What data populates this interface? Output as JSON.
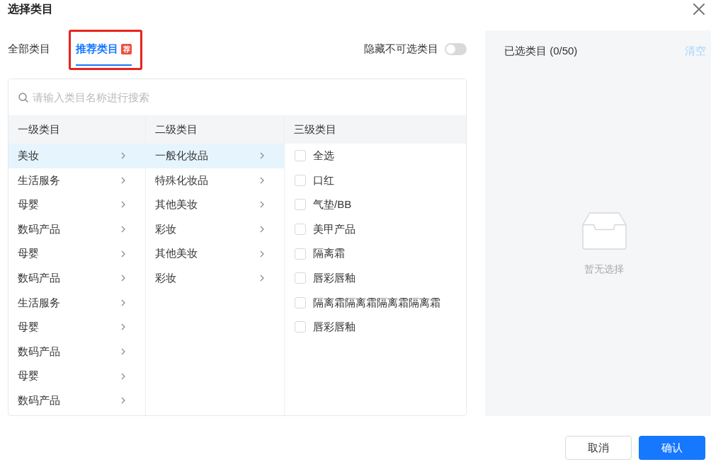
{
  "dialog": {
    "title": "选择类目"
  },
  "tabs": [
    {
      "label": "全部类目",
      "selected": false,
      "highlighted": false
    },
    {
      "label": "推荐类目",
      "selected": true,
      "badge": "荐",
      "highlighted": true
    }
  ],
  "hide_unavailable": {
    "label": "隐藏不可选类目",
    "on": false
  },
  "search": {
    "placeholder": "请输入类目名称进行搜索"
  },
  "columns": [
    {
      "title": "一级类目",
      "kind": "nav",
      "items": [
        {
          "label": "美妆",
          "selected": true
        },
        {
          "label": "生活服务",
          "selected": false
        },
        {
          "label": "母婴",
          "selected": false
        },
        {
          "label": "数码产品",
          "selected": false
        },
        {
          "label": "母婴",
          "selected": false
        },
        {
          "label": "数码产品",
          "selected": false
        },
        {
          "label": "生活服务",
          "selected": false
        },
        {
          "label": "母婴",
          "selected": false
        },
        {
          "label": "数码产品",
          "selected": false
        },
        {
          "label": "母婴",
          "selected": false
        },
        {
          "label": "数码产品",
          "selected": false
        }
      ]
    },
    {
      "title": "二级类目",
      "kind": "nav",
      "items": [
        {
          "label": "一般化妆品",
          "selected": true
        },
        {
          "label": "特殊化妆品",
          "selected": false
        },
        {
          "label": "其他美妆",
          "selected": false
        },
        {
          "label": "彩妆",
          "selected": false
        },
        {
          "label": "其他美妆",
          "selected": false
        },
        {
          "label": "彩妆",
          "selected": false
        }
      ]
    },
    {
      "title": "三级类目",
      "kind": "checklist",
      "items": [
        {
          "label": "全选",
          "checked": false
        },
        {
          "label": "口红",
          "checked": false
        },
        {
          "label": "气垫/BB",
          "checked": false
        },
        {
          "label": "美甲产品",
          "checked": false
        },
        {
          "label": "隔离霜",
          "checked": false
        },
        {
          "label": "唇彩唇釉",
          "checked": false
        },
        {
          "label": "隔离霜隔离霜隔离霜隔离霜",
          "checked": false
        },
        {
          "label": "唇彩唇釉",
          "checked": false
        }
      ]
    }
  ],
  "selected_panel": {
    "title": "已选类目 (0/50)",
    "clear": {
      "label": "清空",
      "disabled": true
    },
    "empty_text": "暂无选择"
  },
  "buttons": [
    {
      "label": "取消",
      "kind": "secondary"
    },
    {
      "label": "确认",
      "kind": "primary"
    }
  ]
}
